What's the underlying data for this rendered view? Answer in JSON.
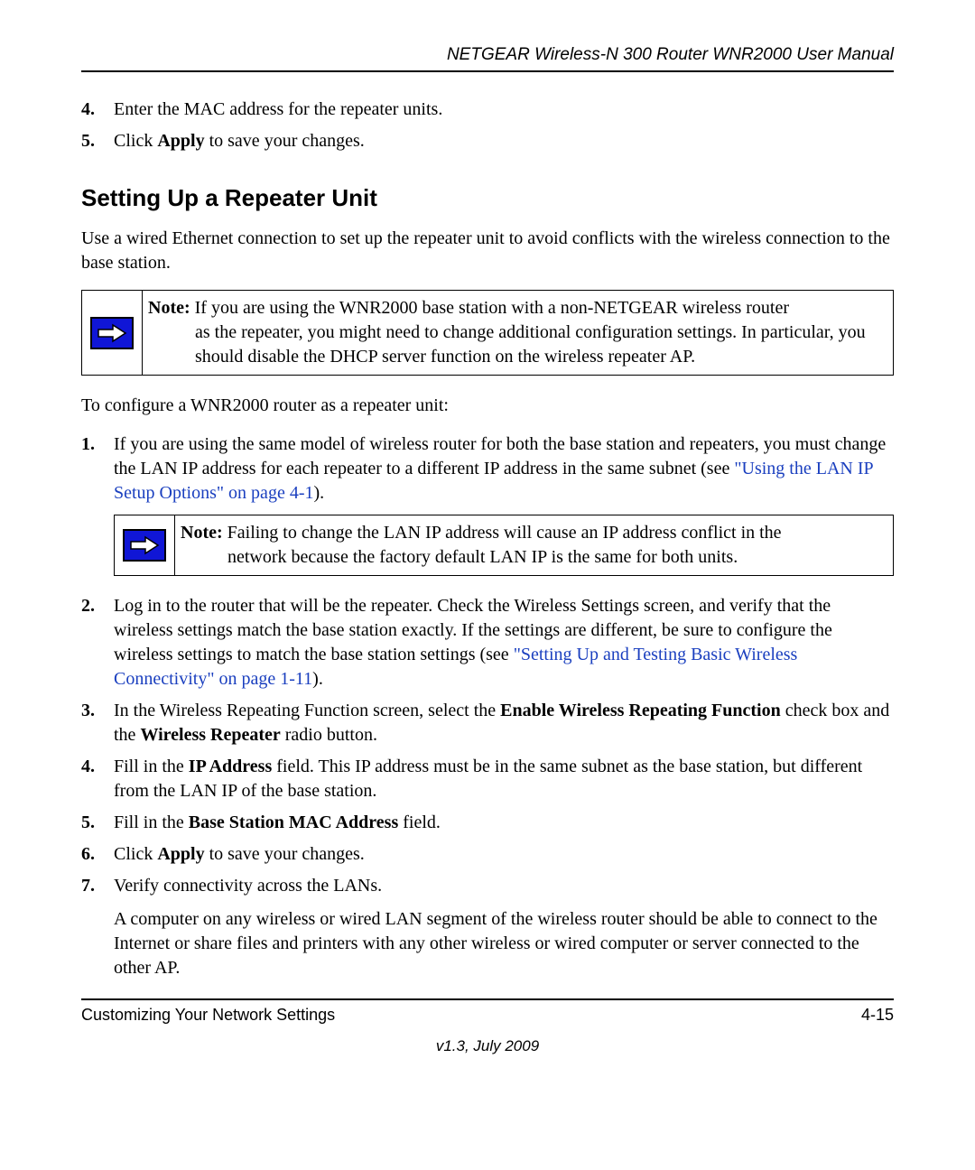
{
  "header": {
    "title": "NETGEAR Wireless-N 300 Router WNR2000 User Manual"
  },
  "topList": {
    "item4": {
      "num": "4.",
      "text": "Enter the MAC address for the repeater units."
    },
    "item5": {
      "num": "5.",
      "pre": "Click ",
      "bold": "Apply",
      "post": " to save your changes."
    }
  },
  "section": {
    "heading": "Setting Up a Repeater Unit",
    "intro": "Use a wired Ethernet connection to set up the repeater unit to avoid conflicts with the wireless connection to the base station."
  },
  "note1": {
    "label": "Note:",
    "line1": " If you are using the WNR2000 base station with a non-NETGEAR wireless router",
    "rest": "as the repeater, you might need to change additional configuration settings. In particular, you should disable the DHCP server function on the wireless repeater AP."
  },
  "configLead": "To configure a WNR2000 router as a repeater unit:",
  "steps": {
    "s1": {
      "num": "1.",
      "pre": "If you are using the same model of wireless router for both the base station and repeaters, you must change the LAN IP address for each repeater to a different IP address in the same subnet (see ",
      "link": "\"Using the LAN IP Setup Options\" on page 4-1",
      "post": ")."
    },
    "s2": {
      "num": "2.",
      "pre": "Log in to the router that will be the repeater. Check the Wireless Settings screen, and verify that the wireless settings match the base station exactly. If the settings are different, be sure to configure the wireless settings to match the base station settings (see ",
      "link": "\"Setting Up and Testing Basic Wireless Connectivity\" on page 1-11",
      "post": ")."
    },
    "s3": {
      "num": "3.",
      "pre": "In the Wireless Repeating Function screen, select the ",
      "b1": "Enable Wireless Repeating Function",
      "mid": " check box and the ",
      "b2": "Wireless Repeater",
      "post": " radio button."
    },
    "s4": {
      "num": "4.",
      "pre": "Fill in the ",
      "b1": "IP Address",
      "post": " field. This IP address must be in the same subnet as the base station, but different from the LAN IP of the base station."
    },
    "s5": {
      "num": "5.",
      "pre": "Fill in the ",
      "b1": "Base Station MAC Address",
      "post": " field."
    },
    "s6": {
      "num": "6.",
      "pre": "Click ",
      "b1": "Apply",
      "post": " to save your changes."
    },
    "s7": {
      "num": "7.",
      "text": "Verify connectivity across the LANs.",
      "sub": "A computer on any wireless or wired LAN segment of the wireless router should be able to connect to the Internet or share files and printers with any other wireless or wired computer or server connected to the other AP."
    }
  },
  "note2": {
    "label": "Note:",
    "line1": " Failing to change the LAN IP address will cause an IP address conflict in the",
    "rest": "network because the factory default LAN IP is the same for both units."
  },
  "footer": {
    "left": "Customizing Your Network Settings",
    "right": "4-15",
    "version": "v1.3, July 2009"
  }
}
